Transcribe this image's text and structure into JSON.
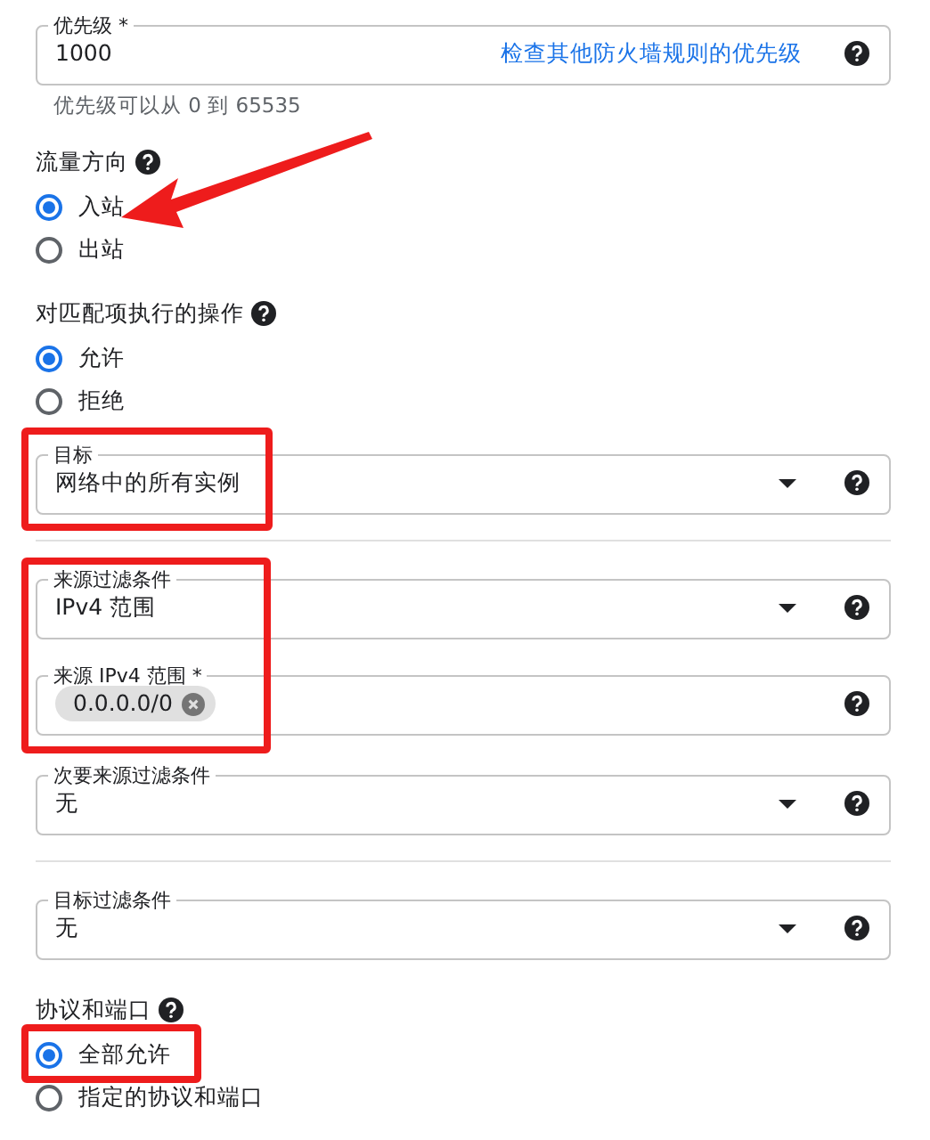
{
  "items": [
    {
      "kind": "text-field",
      "label": "优先级 *",
      "value": "1000",
      "link": "检查其他防火墙规则的优先级",
      "hint": "优先级可以从 0 到 65535"
    },
    {
      "kind": "radio-group",
      "title": "流量方向",
      "options": [
        {
          "label": "入站",
          "selected": true
        },
        {
          "label": "出站",
          "selected": false
        }
      ]
    },
    {
      "kind": "radio-group",
      "title": "对匹配项执行的操作",
      "options": [
        {
          "label": "允许",
          "selected": true
        },
        {
          "label": "拒绝",
          "selected": false
        }
      ]
    },
    {
      "kind": "select",
      "label": "目标",
      "value": "网络中的所有实例",
      "divider_after": true
    },
    {
      "kind": "select",
      "label": "来源过滤条件",
      "value": "IPv4 范围",
      "divider_after": false
    },
    {
      "kind": "chips",
      "label": "来源 IPv4 范围 *",
      "chips": [
        "0.0.0.0/0"
      ]
    },
    {
      "kind": "select",
      "label": "次要来源过滤条件",
      "value": "无",
      "divider_after": true
    },
    {
      "kind": "select",
      "label": "目标过滤条件",
      "value": "无",
      "divider_after": false
    },
    {
      "kind": "radio-group",
      "title": "协议和端口",
      "options": [
        {
          "label": "全部允许",
          "selected": true
        },
        {
          "label": "指定的协议和端口",
          "selected": false
        }
      ]
    }
  ],
  "annotations": [
    {
      "kind": "arrow"
    },
    {
      "kind": "box"
    },
    {
      "kind": "box"
    },
    {
      "kind": "box"
    }
  ]
}
